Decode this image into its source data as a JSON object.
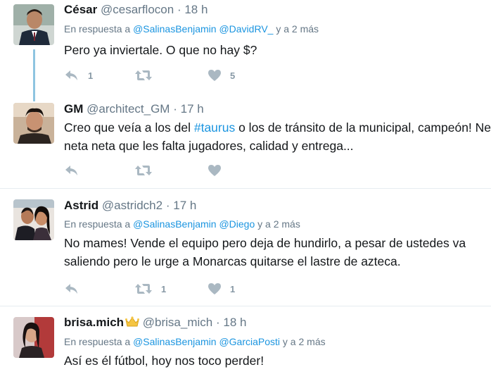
{
  "tweets": [
    {
      "name": "César",
      "handle": "@cesarflocon",
      "separator": "·",
      "time": "18 h",
      "reply_prefix": "En respuesta a",
      "reply_mentions": [
        "@SalinasBenjamin",
        "@DavidRV_"
      ],
      "reply_suffix": "y a 2 más",
      "text_lines": [
        "Pero ya inviertale. O que no hay $?"
      ],
      "reply_count": "1",
      "retweet_count": "",
      "like_count": "5"
    },
    {
      "name": "GM",
      "handle": "@architect_GM",
      "separator": "·",
      "time": "17 h",
      "text_before_hashtag": "Creo que veía a los del ",
      "hashtag": "#taurus",
      "text_after_hashtag": " o los de tránsito de la municipal, campeón! Ne",
      "text_line2": "neta neta que les falta jugadores, calidad y entrega...",
      "reply_count": "",
      "retweet_count": "",
      "like_count": ""
    },
    {
      "name": "Astrid",
      "handle": "@astridch2",
      "separator": "·",
      "time": "17 h",
      "reply_prefix": "En respuesta a",
      "reply_mentions": [
        "@SalinasBenjamin",
        "@Diego"
      ],
      "reply_suffix": "y a 2 más",
      "text_lines": [
        "No mames! Vende el equipo pero deja de hundirlo, a pesar de ustedes va",
        "saliendo pero le urge a Monarcas quitarse el lastre de azteca."
      ],
      "reply_count": "",
      "retweet_count": "1",
      "like_count": "1"
    },
    {
      "name": "brisa.mich",
      "handle": "@brisa_mich",
      "separator": "·",
      "time": "18 h",
      "reply_prefix": "En respuesta a",
      "reply_mentions": [
        "@SalinasBenjamin",
        "@GarciaPosti"
      ],
      "reply_suffix": "y a 2 más",
      "text_lines": [
        "Así es él fútbol, hoy nos toco perder!"
      ]
    }
  ],
  "colors": {
    "link": "#1b95e0",
    "muted": "#657786",
    "icon": "#aab8c2",
    "thread_line": "#8ec4e0",
    "divider": "#e6ecf0"
  },
  "icons": [
    "reply-icon",
    "retweet-icon",
    "heart-icon",
    "crown-icon"
  ]
}
